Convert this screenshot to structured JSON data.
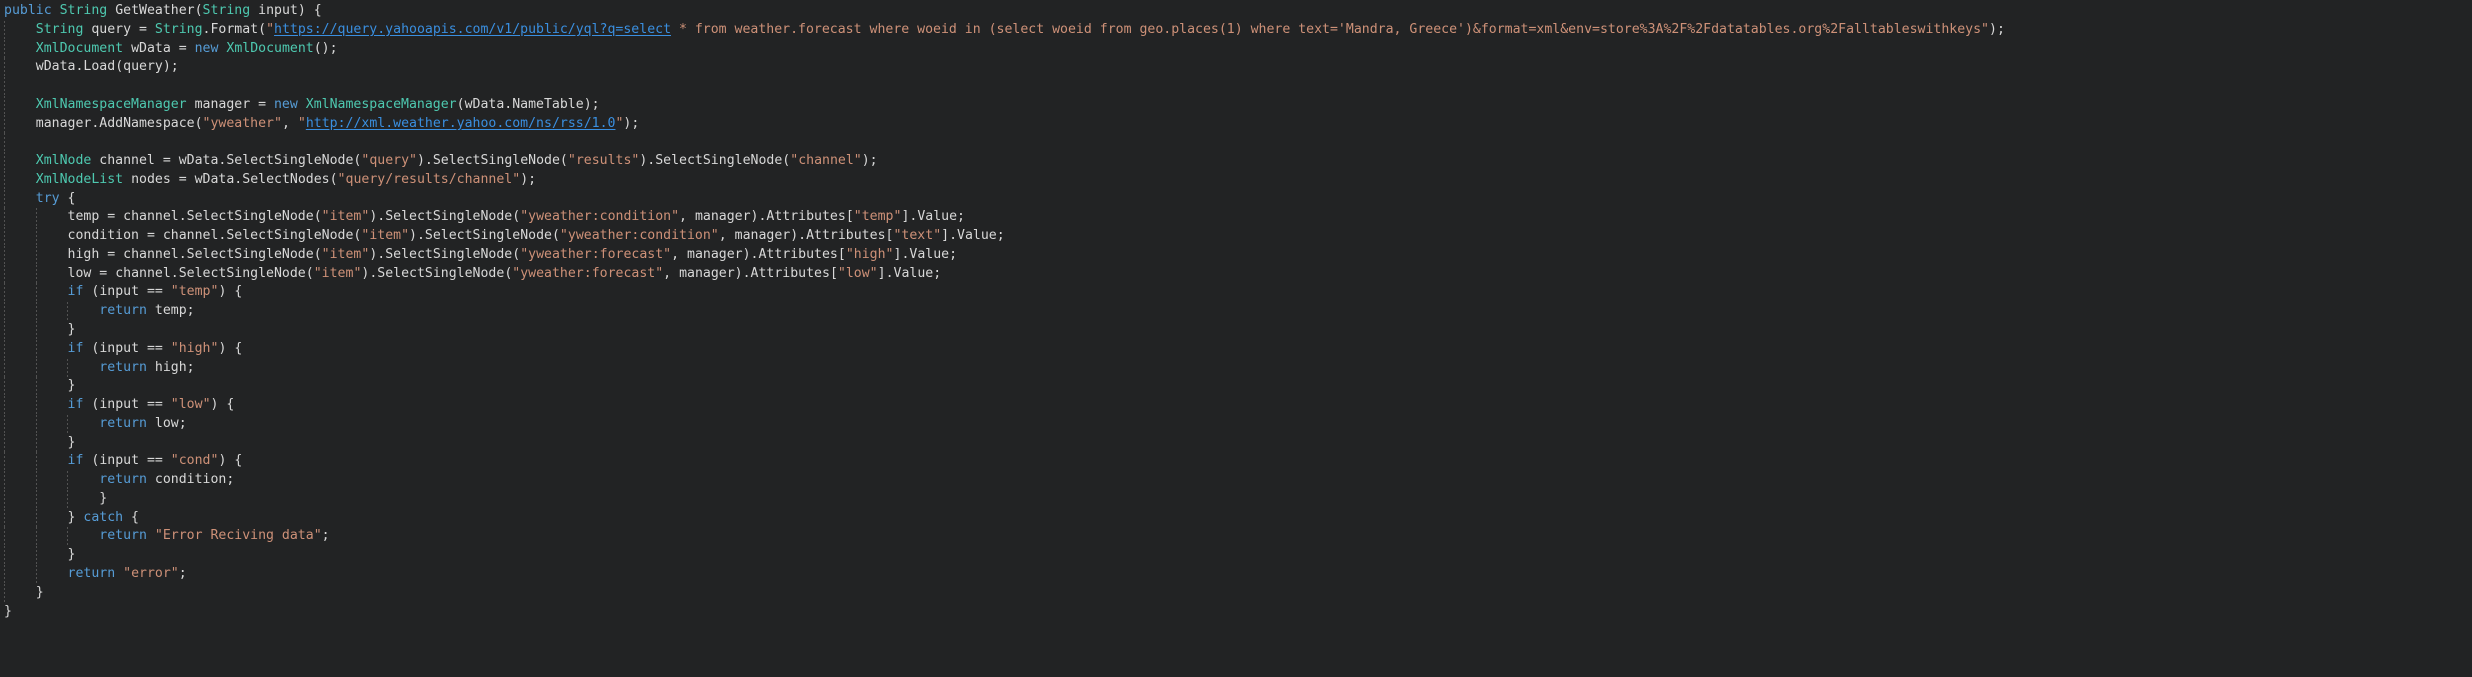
{
  "editor": {
    "language": "csharp",
    "theme": "dark",
    "background_color": "#222324",
    "colors": {
      "keyword": "#569cd6",
      "type": "#4ec9b0",
      "string": "#ce9178",
      "plain": "#d8d8d8",
      "link": "#3a8fe0",
      "indent_guide": "#5a5a5a"
    },
    "urls": {
      "yql_endpoint": "https://query.yahooapis.com/v1/public/yql?q=select",
      "yweather_ns": "http://xml.weather.yahoo.com/ns/rss/1.0"
    },
    "code_lines": [
      "public String GetWeather(String input) {",
      "    String query = String.Format(\"https://query.yahooapis.com/v1/public/yql?q=select * from weather.forecast where woeid in (select woeid from geo.places(1) where text='Mandra, Greece')&format=xml&env=store%3A%2F%2Fdatatables.org%2Falltableswithkeys\");",
      "    XmlDocument wData = new XmlDocument();",
      "    wData.Load(query);",
      "",
      "    XmlNamespaceManager manager = new XmlNamespaceManager(wData.NameTable);",
      "    manager.AddNamespace(\"yweather\", \"http://xml.weather.yahoo.com/ns/rss/1.0\");",
      "",
      "    XmlNode channel = wData.SelectSingleNode(\"query\").SelectSingleNode(\"results\").SelectSingleNode(\"channel\");",
      "    XmlNodeList nodes = wData.SelectNodes(\"query/results/channel\");",
      "    try {",
      "        temp = channel.SelectSingleNode(\"item\").SelectSingleNode(\"yweather:condition\", manager).Attributes[\"temp\"].Value;",
      "        condition = channel.SelectSingleNode(\"item\").SelectSingleNode(\"yweather:condition\", manager).Attributes[\"text\"].Value;",
      "        high = channel.SelectSingleNode(\"item\").SelectSingleNode(\"yweather:forecast\", manager).Attributes[\"high\"].Value;",
      "        low = channel.SelectSingleNode(\"item\").SelectSingleNode(\"yweather:forecast\", manager).Attributes[\"low\"].Value;",
      "        if (input == \"temp\") {",
      "            return temp;",
      "        }",
      "        if (input == \"high\") {",
      "            return high;",
      "        }",
      "        if (input == \"low\") {",
      "            return low;",
      "        }",
      "        if (input == \"cond\") {",
      "            return condition;",
      "            }",
      "        } catch {",
      "            return \"Error Reciving data\";",
      "        }",
      "        return \"error\";",
      "    }",
      "}"
    ],
    "string_literals": [
      "yweather",
      "query",
      "results",
      "channel",
      "query/results/channel",
      "item",
      "yweather:condition",
      "temp",
      "text",
      "yweather:forecast",
      "high",
      "low",
      "cond",
      "Error Reciving data",
      "error",
      "Mandra, Greece"
    ],
    "keywords": [
      "public",
      "new",
      "try",
      "catch",
      "return",
      "if"
    ],
    "types": [
      "String",
      "XmlDocument",
      "XmlNamespaceManager",
      "XmlNode",
      "XmlNodeList"
    ],
    "method_name": "GetWeather",
    "parameter_name": "input",
    "error_messages": [
      "Error Reciving data",
      "error"
    ]
  }
}
